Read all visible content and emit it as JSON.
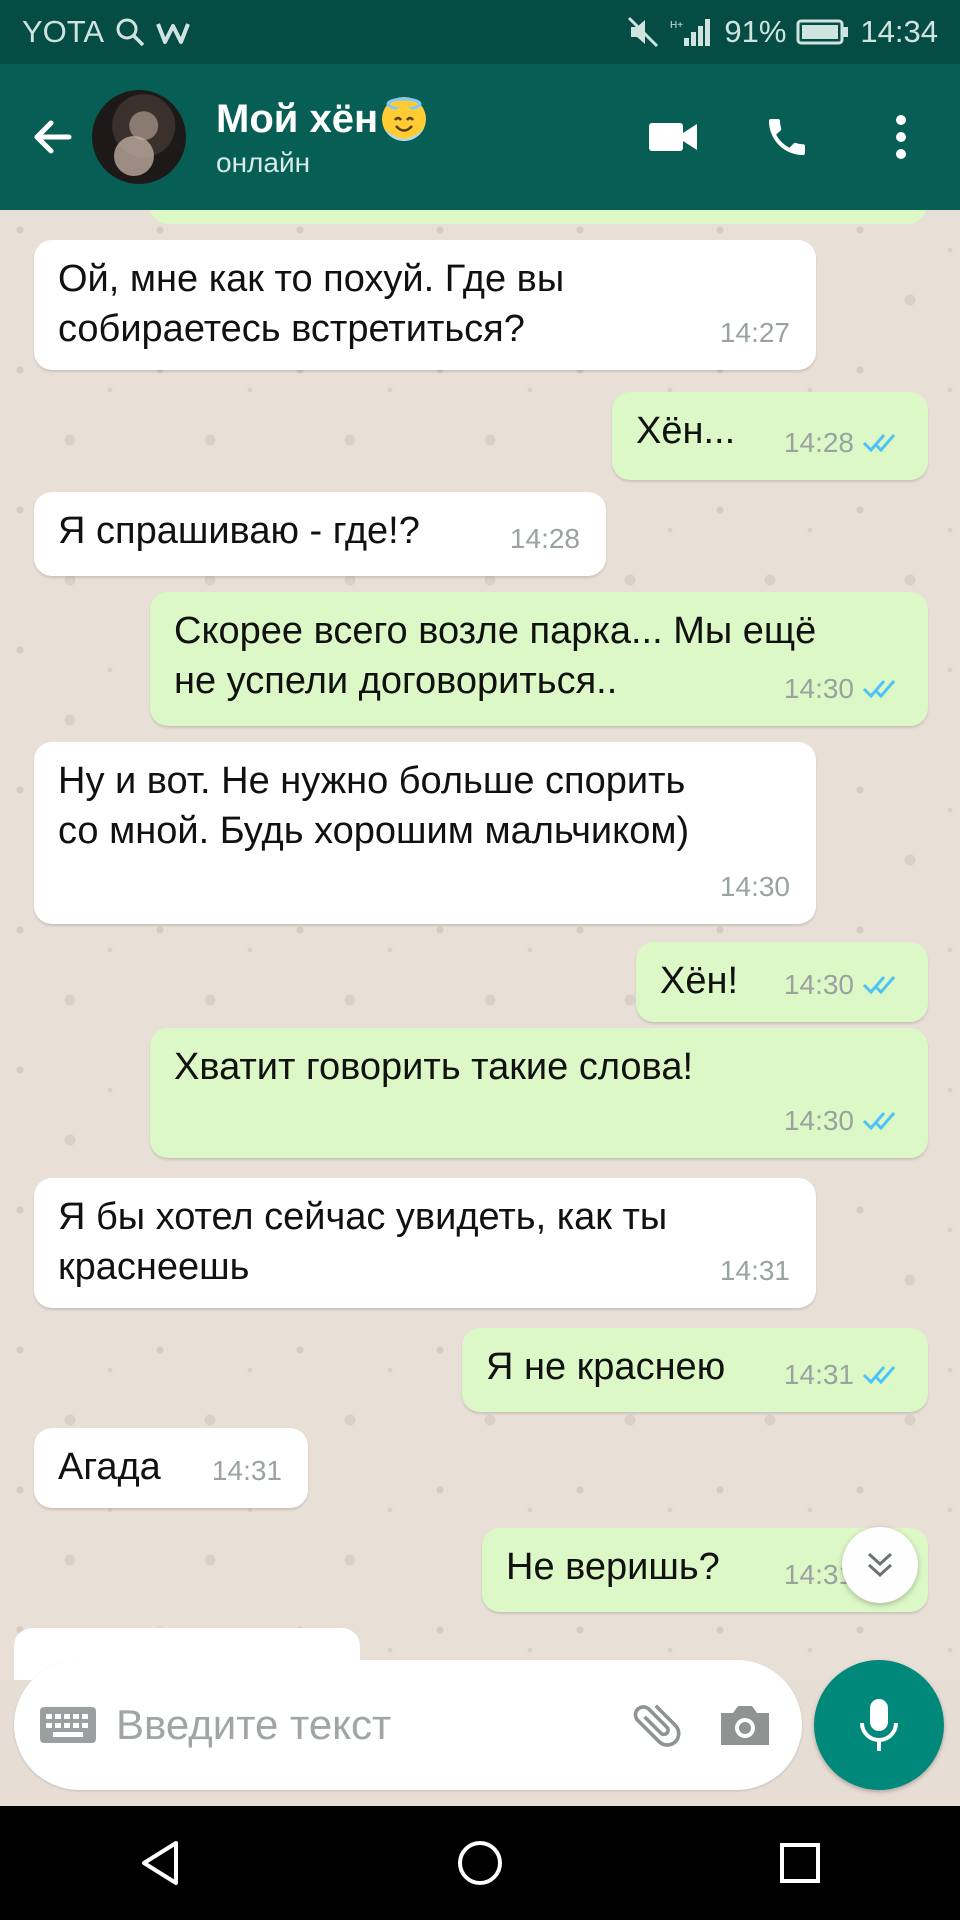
{
  "status_bar": {
    "carrier": "YOTA",
    "battery_percent": "91%",
    "time": "14:34"
  },
  "header": {
    "contact_name": "Мой хён",
    "contact_emoji": "smiling-face-with-halo",
    "contact_status": "онлайн",
    "icons": [
      "back-arrow-icon",
      "video-call-icon",
      "phone-icon",
      "more-vert-icon"
    ]
  },
  "messages": [
    {
      "dir": "in",
      "text": "Ой, мне как то похуй. Где вы\nсобираетесь встретиться?",
      "time": "14:27"
    },
    {
      "dir": "out",
      "text": "Хён...",
      "time": "14:28"
    },
    {
      "dir": "in",
      "text": "Я спрашиваю - где!?",
      "time": "14:28"
    },
    {
      "dir": "out",
      "text": "Скорее всего возле парка... Мы ещё\nне успели договориться..",
      "time": "14:30"
    },
    {
      "dir": "in",
      "text": "Ну и вот. Не нужно больше спорить\nсо мной. Будь хорошим мальчиком)",
      "time": "14:30"
    },
    {
      "dir": "out",
      "text": "Хён!",
      "time": "14:30"
    },
    {
      "dir": "out",
      "text": "Хватит говорить такие слова!",
      "time": "14:30"
    },
    {
      "dir": "in",
      "text": "Я бы хотел сейчас увидеть, как ты\nкраснеешь",
      "time": "14:31"
    },
    {
      "dir": "out",
      "text": "Я не краснею",
      "time": "14:31"
    },
    {
      "dir": "in",
      "text": "Агада",
      "time": "14:31"
    },
    {
      "dir": "out",
      "text": "Не веришь?",
      "time": "14:31"
    }
  ],
  "composer": {
    "placeholder": "Введите текст"
  },
  "colors": {
    "header": "#075e54",
    "status_bar": "#054c44",
    "outgoing_bubble": "#dcf8c6",
    "incoming_bubble": "#ffffff",
    "read_ticks": "#4fc3f7",
    "mic_button": "#00897b"
  }
}
